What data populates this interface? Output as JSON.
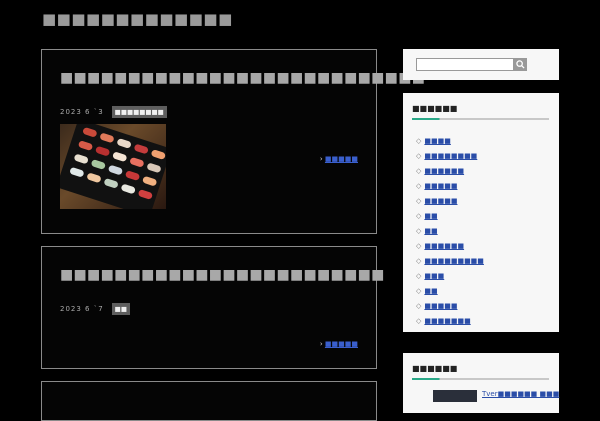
{
  "site": {
    "title": "■■■■■■■■■■■■■"
  },
  "posts": [
    {
      "title": "■■■■■■■■■■■■■■■■■■■■■■■■■■■",
      "date": "2023 6 `3",
      "category": "■■■■■■■■",
      "read_more": "■■■■■"
    },
    {
      "title": "■■■■■■■■■■■■■■■■■■■■■■■■",
      "date": "2023 6 `7",
      "category": "■■",
      "read_more": "■■■■■"
    }
  ],
  "sidebar": {
    "search": {
      "placeholder": ""
    },
    "categories": {
      "title": "■■■■■■",
      "items": [
        {
          "label": "■■■■"
        },
        {
          "label": "■■■■■■■■"
        },
        {
          "label": "■■■■■■"
        },
        {
          "label": "■■■■■"
        },
        {
          "label": "■■■■■"
        },
        {
          "label": "■■"
        },
        {
          "label": "■■"
        },
        {
          "label": "■■■■■■"
        },
        {
          "label": "■■■■■■■■■"
        },
        {
          "label": "■■■"
        },
        {
          "label": "■■"
        },
        {
          "label": "■■■■■"
        },
        {
          "label": "■■■■■■■"
        }
      ]
    },
    "recent": {
      "title": "■■■■■■",
      "items": [
        {
          "label": "Tver■■■■■■ ■■■"
        }
      ]
    }
  },
  "colors": {
    "accent": "#2aa888",
    "link": "#2a4da8"
  }
}
